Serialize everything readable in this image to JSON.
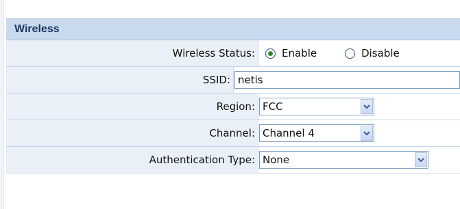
{
  "section": {
    "title": "Wireless"
  },
  "rows": {
    "wireless_status": {
      "label": "Wireless Status:",
      "options": [
        {
          "label": "Enable",
          "checked": true
        },
        {
          "label": "Disable",
          "checked": false
        }
      ]
    },
    "ssid": {
      "label": "SSID:",
      "value": "netis"
    },
    "region": {
      "label": "Region:",
      "value": "FCC"
    },
    "channel": {
      "label": "Channel:",
      "value": "Channel 4"
    },
    "authentication_type": {
      "label": "Authentication Type:",
      "value": "None"
    }
  },
  "icons": {
    "dropdown": "chevron-down-icon",
    "radio_checked": "radio-checked-icon",
    "radio_unchecked": "radio-unchecked-icon"
  },
  "colors": {
    "header_bg": "#c9d9ee",
    "label_bg": "#eaf0f8",
    "accent_text": "#15335e"
  }
}
